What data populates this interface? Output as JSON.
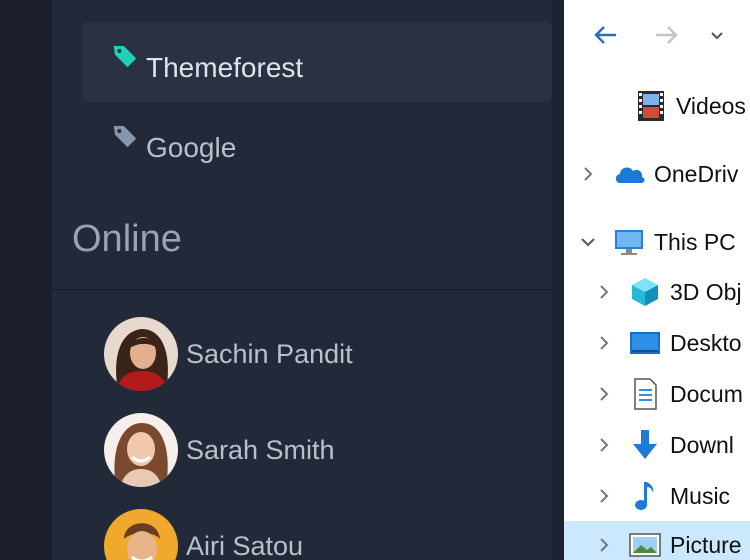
{
  "sidebar": {
    "tags": [
      {
        "label": "Themeforest",
        "active": true,
        "color": "#1fd1b5"
      },
      {
        "label": "Google",
        "active": false,
        "color": "#8796a8"
      }
    ],
    "online_title": "Online",
    "users": [
      {
        "name": "Sachin Pandit",
        "avatar": "avatar-woman-dark-hair"
      },
      {
        "name": "Sarah Smith",
        "avatar": "avatar-woman-smiling"
      },
      {
        "name": "Airi Satou",
        "avatar": "avatar-man-orange-bg"
      }
    ]
  },
  "explorer": {
    "nav": {
      "back": "back-arrow-icon",
      "forward": "forward-arrow-icon",
      "recent": "chevron-down-icon"
    },
    "tree": [
      {
        "label": "Videos",
        "icon": "film-icon",
        "indent": 1,
        "expander": "none"
      },
      {
        "label": "OneDriv",
        "icon": "cloud-icon",
        "indent": 0,
        "expander": "collapsed"
      },
      {
        "label": "This PC",
        "icon": "monitor-icon",
        "indent": 0,
        "expander": "expanded"
      },
      {
        "label": "3D Obj",
        "icon": "cube-icon",
        "indent": 1,
        "expander": "collapsed"
      },
      {
        "label": "Deskto",
        "icon": "desktop-icon",
        "indent": 1,
        "expander": "collapsed"
      },
      {
        "label": "Docum",
        "icon": "document-icon",
        "indent": 1,
        "expander": "collapsed"
      },
      {
        "label": "Downl",
        "icon": "download-icon",
        "indent": 1,
        "expander": "collapsed"
      },
      {
        "label": "Music",
        "icon": "music-note-icon",
        "indent": 1,
        "expander": "collapsed"
      },
      {
        "label": "Picture",
        "icon": "picture-icon",
        "indent": 1,
        "expander": "collapsed",
        "selected": true
      }
    ]
  }
}
